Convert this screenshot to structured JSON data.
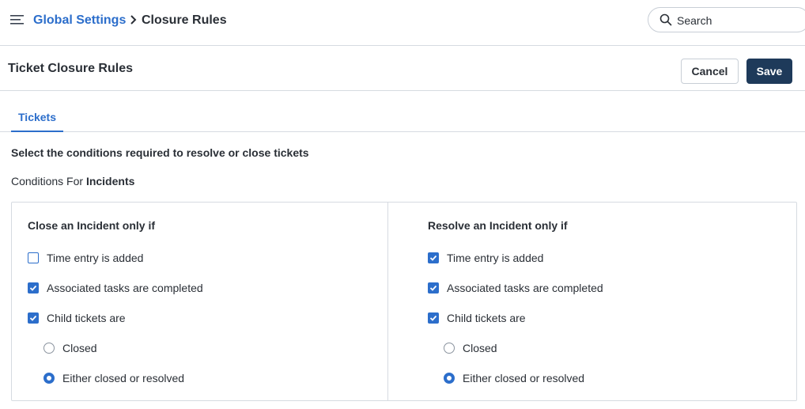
{
  "topbar": {
    "breadcrumb_parent": "Global Settings",
    "breadcrumb_current": "Closure Rules",
    "search_placeholder": "Search"
  },
  "header": {
    "title": "Ticket Closure Rules",
    "cancel_label": "Cancel",
    "save_label": "Save"
  },
  "tabs": [
    {
      "label": "Tickets",
      "active": true
    }
  ],
  "content": {
    "heading": "Select the conditions required to resolve or close tickets",
    "conditions_prefix": "Conditions For",
    "conditions_type": "Incidents"
  },
  "close_rules": {
    "title": "Close an Incident only if",
    "time_entry": {
      "label": "Time entry is added",
      "checked": false
    },
    "tasks_completed": {
      "label": "Associated tasks are completed",
      "checked": true
    },
    "child_tickets": {
      "label": "Child tickets are",
      "checked": true
    },
    "option_closed": {
      "label": "Closed",
      "selected": false
    },
    "option_either": {
      "label": "Either closed or resolved",
      "selected": true
    }
  },
  "resolve_rules": {
    "title": "Resolve an Incident only if",
    "time_entry": {
      "label": "Time entry is added",
      "checked": true
    },
    "tasks_completed": {
      "label": "Associated tasks are completed",
      "checked": true
    },
    "child_tickets": {
      "label": "Child tickets are",
      "checked": true
    },
    "option_closed": {
      "label": "Closed",
      "selected": false
    },
    "option_either": {
      "label": "Either closed or resolved",
      "selected": true
    }
  },
  "colors": {
    "accent": "#2c6ecb",
    "primary_button": "#1e3a5a",
    "border": "#d6dbe1"
  },
  "icons": {
    "menu": "hamburger-menu-icon",
    "breadcrumb_separator": "chevron-right-icon",
    "search": "search-icon",
    "checked": "checkmark-icon"
  }
}
